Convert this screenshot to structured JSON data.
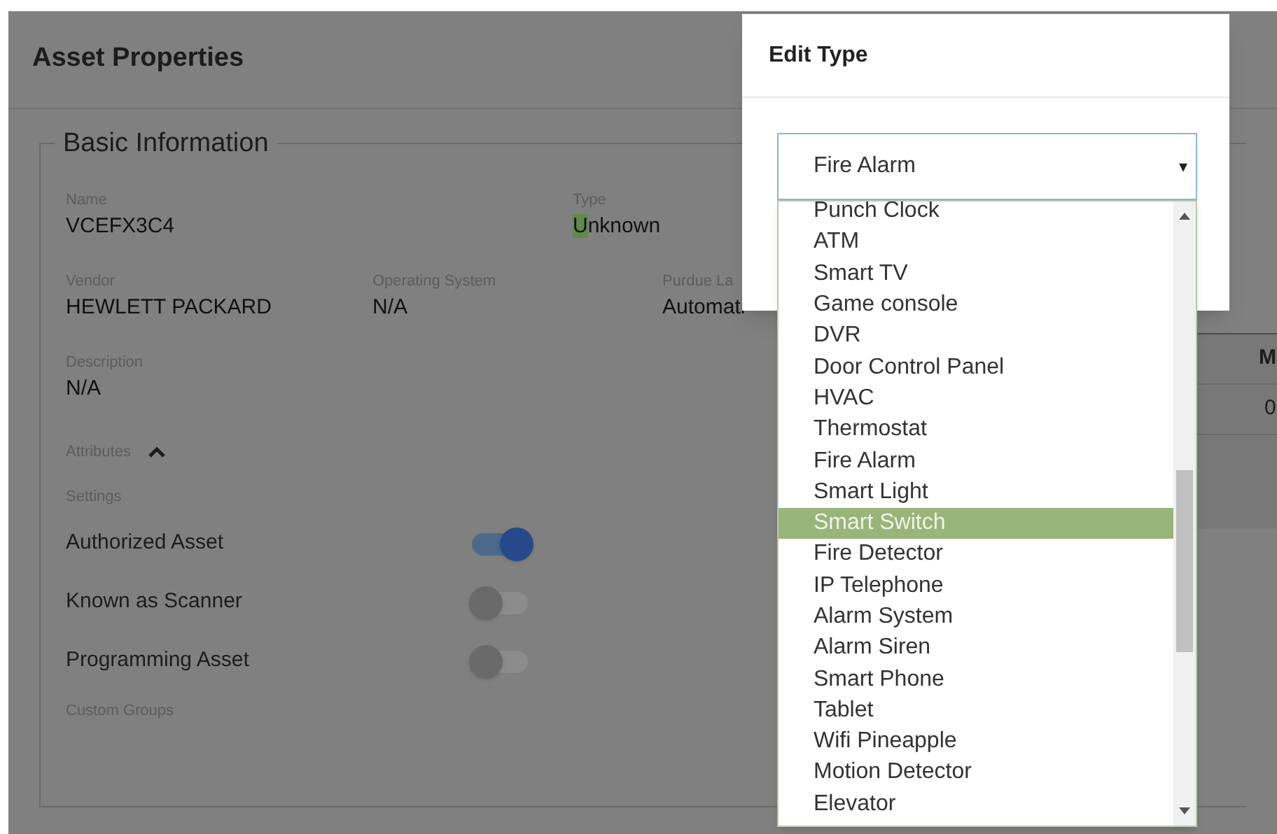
{
  "page": {
    "title": "Asset Properties"
  },
  "section": {
    "title": "Basic Information"
  },
  "fields": [
    {
      "label": "Name",
      "value": "VCEFX3C4"
    },
    {
      "label": "Type",
      "value": "Unknown"
    },
    {
      "label": "Vendor",
      "value": "HEWLETT PACKARD"
    },
    {
      "label": "Operating System",
      "value": "N/A"
    },
    {
      "label": "Purdue La",
      "value": "Automati"
    },
    {
      "label": "Description",
      "value": "N/A"
    }
  ],
  "attributes": {
    "label": "Attributes",
    "expanded": true
  },
  "settings": {
    "label": "Settings",
    "toggles": [
      {
        "label": "Authorized Asset",
        "on": true
      },
      {
        "label": "Known as Scanner",
        "on": false
      },
      {
        "label": "Programming Asset",
        "on": false
      }
    ]
  },
  "custom_groups": {
    "label": "Custom Groups"
  },
  "table": {
    "columns": [
      "M"
    ],
    "rows": [
      [
        "0"
      ]
    ]
  },
  "dialog": {
    "title": "Edit Type",
    "select": {
      "value": "Fire Alarm",
      "arrow": "▾"
    },
    "options": [
      {
        "label": "Punch Clock",
        "selected": false
      },
      {
        "label": "ATM",
        "selected": false
      },
      {
        "label": "Smart TV",
        "selected": false
      },
      {
        "label": "Game console",
        "selected": false
      },
      {
        "label": "DVR",
        "selected": false
      },
      {
        "label": "Door Control Panel",
        "selected": false
      },
      {
        "label": "HVAC",
        "selected": false
      },
      {
        "label": "Thermostat",
        "selected": false
      },
      {
        "label": "Fire Alarm",
        "selected": false
      },
      {
        "label": "Smart Light",
        "selected": false
      },
      {
        "label": "Smart Switch",
        "selected": true
      },
      {
        "label": "Fire Detector",
        "selected": false
      },
      {
        "label": "IP Telephone",
        "selected": false
      },
      {
        "label": "Alarm System",
        "selected": false
      },
      {
        "label": "Alarm Siren",
        "selected": false
      },
      {
        "label": "Smart Phone",
        "selected": false
      },
      {
        "label": "Tablet",
        "selected": false
      },
      {
        "label": "Wifi Pineapple",
        "selected": false
      },
      {
        "label": "Motion Detector",
        "selected": false
      },
      {
        "label": "Elevator",
        "selected": false
      }
    ]
  }
}
